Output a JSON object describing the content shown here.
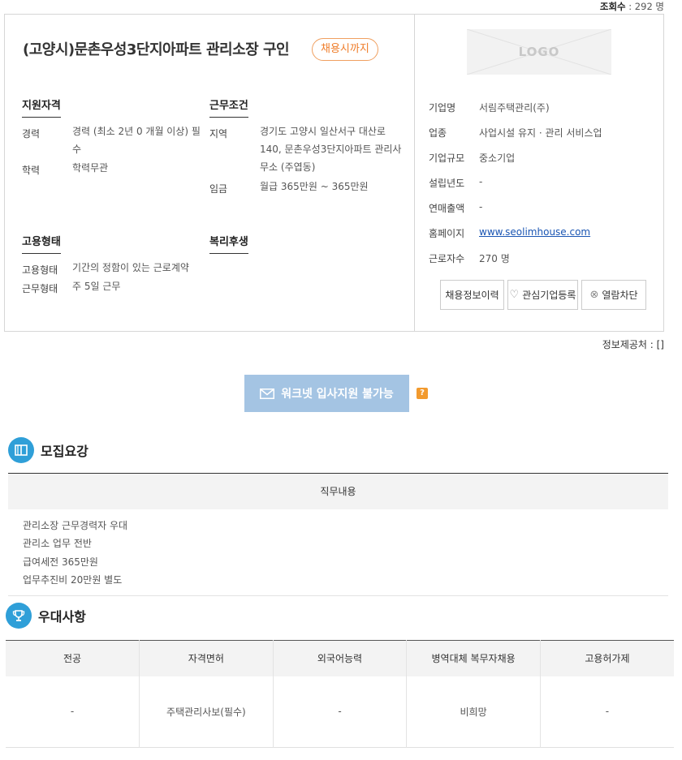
{
  "views": {
    "label": "조회수",
    "value": ": 292 명"
  },
  "job": {
    "title": "(고양시)문촌우성3단지아파트 관리소장 구인",
    "status": "채용시까지"
  },
  "qualification": {
    "title": "지원자격",
    "rows": [
      {
        "label": "경력",
        "value": "경력 (최소 2년 0 개월 이상) 필수"
      },
      {
        "label": "학력",
        "value": "학력무관"
      }
    ]
  },
  "conditions": {
    "title": "근무조건",
    "rows": [
      {
        "label": "지역",
        "value": "경기도 고양시 일산서구 대산로 140, 문촌우성3단지아파트 관리사무소 (주엽동)"
      },
      {
        "label": "임금",
        "value": "월급 365만원 ~ 365만원"
      }
    ]
  },
  "employment": {
    "title": "고용형태",
    "rows": [
      {
        "label": "고용형태",
        "value": "기간의 정함이 있는 근로계약"
      },
      {
        "label": "근무형태",
        "value": "주 5일 근무"
      }
    ]
  },
  "welfare": {
    "title": "복리후생"
  },
  "company": {
    "logo_text": "LOGO",
    "rows": [
      {
        "label": "기업명",
        "value": "서림주택관리(주)"
      },
      {
        "label": "업종",
        "value": "사업시설 유지 · 관리 서비스업"
      },
      {
        "label": "기업규모",
        "value": "중소기업"
      },
      {
        "label": "설립년도",
        "value": "-"
      },
      {
        "label": "연매출액",
        "value": "-"
      },
      {
        "label": "홈페이지",
        "value": "www.seolimhouse.com"
      },
      {
        "label": "근로자수",
        "value": "270 명"
      }
    ],
    "buttons": {
      "history": "채용정보이력",
      "favorite": "관심기업등록",
      "block": "열람차단"
    }
  },
  "disclosure": "정보제공처 : []",
  "apply_button": "워크넷 입사지원 불가능",
  "help_icon": "?",
  "recruit": {
    "title": "모집요강",
    "duty_header": "직무내용",
    "lines": [
      "관리소장 근무경력자 우대",
      "관리소 업무 전반",
      "급여세전 365만원",
      "업무추진비 20만원 별도"
    ]
  },
  "preference": {
    "title": "우대사항",
    "headers": [
      "전공",
      "자격면허",
      "외국어능력",
      "병역대체 복무자채용",
      "고용허가제"
    ],
    "values": [
      "-",
      "주택관리사보(필수)",
      "-",
      "비희망",
      "-"
    ]
  },
  "colors": {
    "accent": "#2f9fd8",
    "status": "#ef7d2a",
    "apply_disabled": "#a4c4e3",
    "help": "#f29a2e",
    "link": "#1a55b3"
  },
  "icons": {
    "recruit": "book-icon",
    "preference": "trophy-icon",
    "apply": "envelope-icon",
    "favorite": "heart-icon",
    "block": "block-icon"
  }
}
